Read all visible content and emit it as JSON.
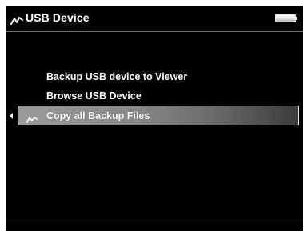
{
  "header": {
    "title": "USB Device",
    "icon": "usb-icon",
    "battery_icon": "battery-icon"
  },
  "menu": {
    "items": [
      {
        "label": "Backup USB device to Viewer"
      },
      {
        "label": "Browse USB Device"
      },
      {
        "label": "Copy all Backup Files",
        "selected": true,
        "icon": "usb-icon"
      }
    ]
  },
  "colors": {
    "background": "#000000",
    "text": "#ffffff",
    "selection_start": "#9a9a9a",
    "selection_end": "#3c3c3c"
  }
}
